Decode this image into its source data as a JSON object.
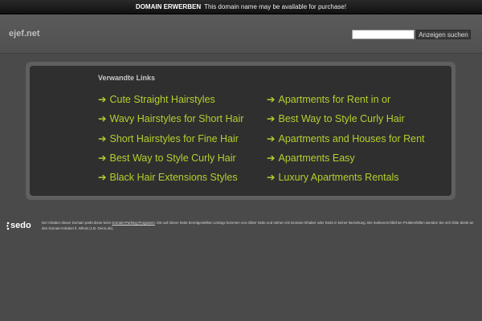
{
  "topbar": {
    "strong": "DOMAIN ERWERBEN",
    "message": "This domain name may be available for purchase!"
  },
  "header": {
    "site_name": "ejef.net",
    "search_placeholder": "",
    "search_button": "Anzeigen suchen"
  },
  "panel": {
    "title": "Verwandte Links",
    "arrow": "➔",
    "links_left": [
      "Cute Straight Hairstyles",
      "Wavy Hairstyles for Short Hair",
      "Short Hairstyles for Fine Hair",
      "Best Way to Style Curly Hair",
      "Black Hair Extensions Styles"
    ],
    "links_right": [
      "Apartments for Rent in or",
      "Best Way to Style Curly Hair",
      "Apartments and Houses for Rent",
      "Apartments Easy",
      "Luxury Apartments Rentals"
    ]
  },
  "footer": {
    "logo_text": "sedo",
    "text_1": "Der Inhaber dieser Domain parkt diese beim",
    "link": "Domain-Parking-Programm",
    "text_2": ". Die auf dieser Seite bereitgestellten Listings kommen von dritter Seite und stehen mit Domain-Inhaber oder Sedo in keiner Beziehung. Bei markenrechtlichen Problemfällen wenden Sie sich bitte direkt an den Domain-Inhaber lt. Whois (z.B. Denic.de)."
  },
  "colors": {
    "background": "#4a4a4a",
    "panel": "#2f2f2f",
    "link": "#b3d02e"
  }
}
